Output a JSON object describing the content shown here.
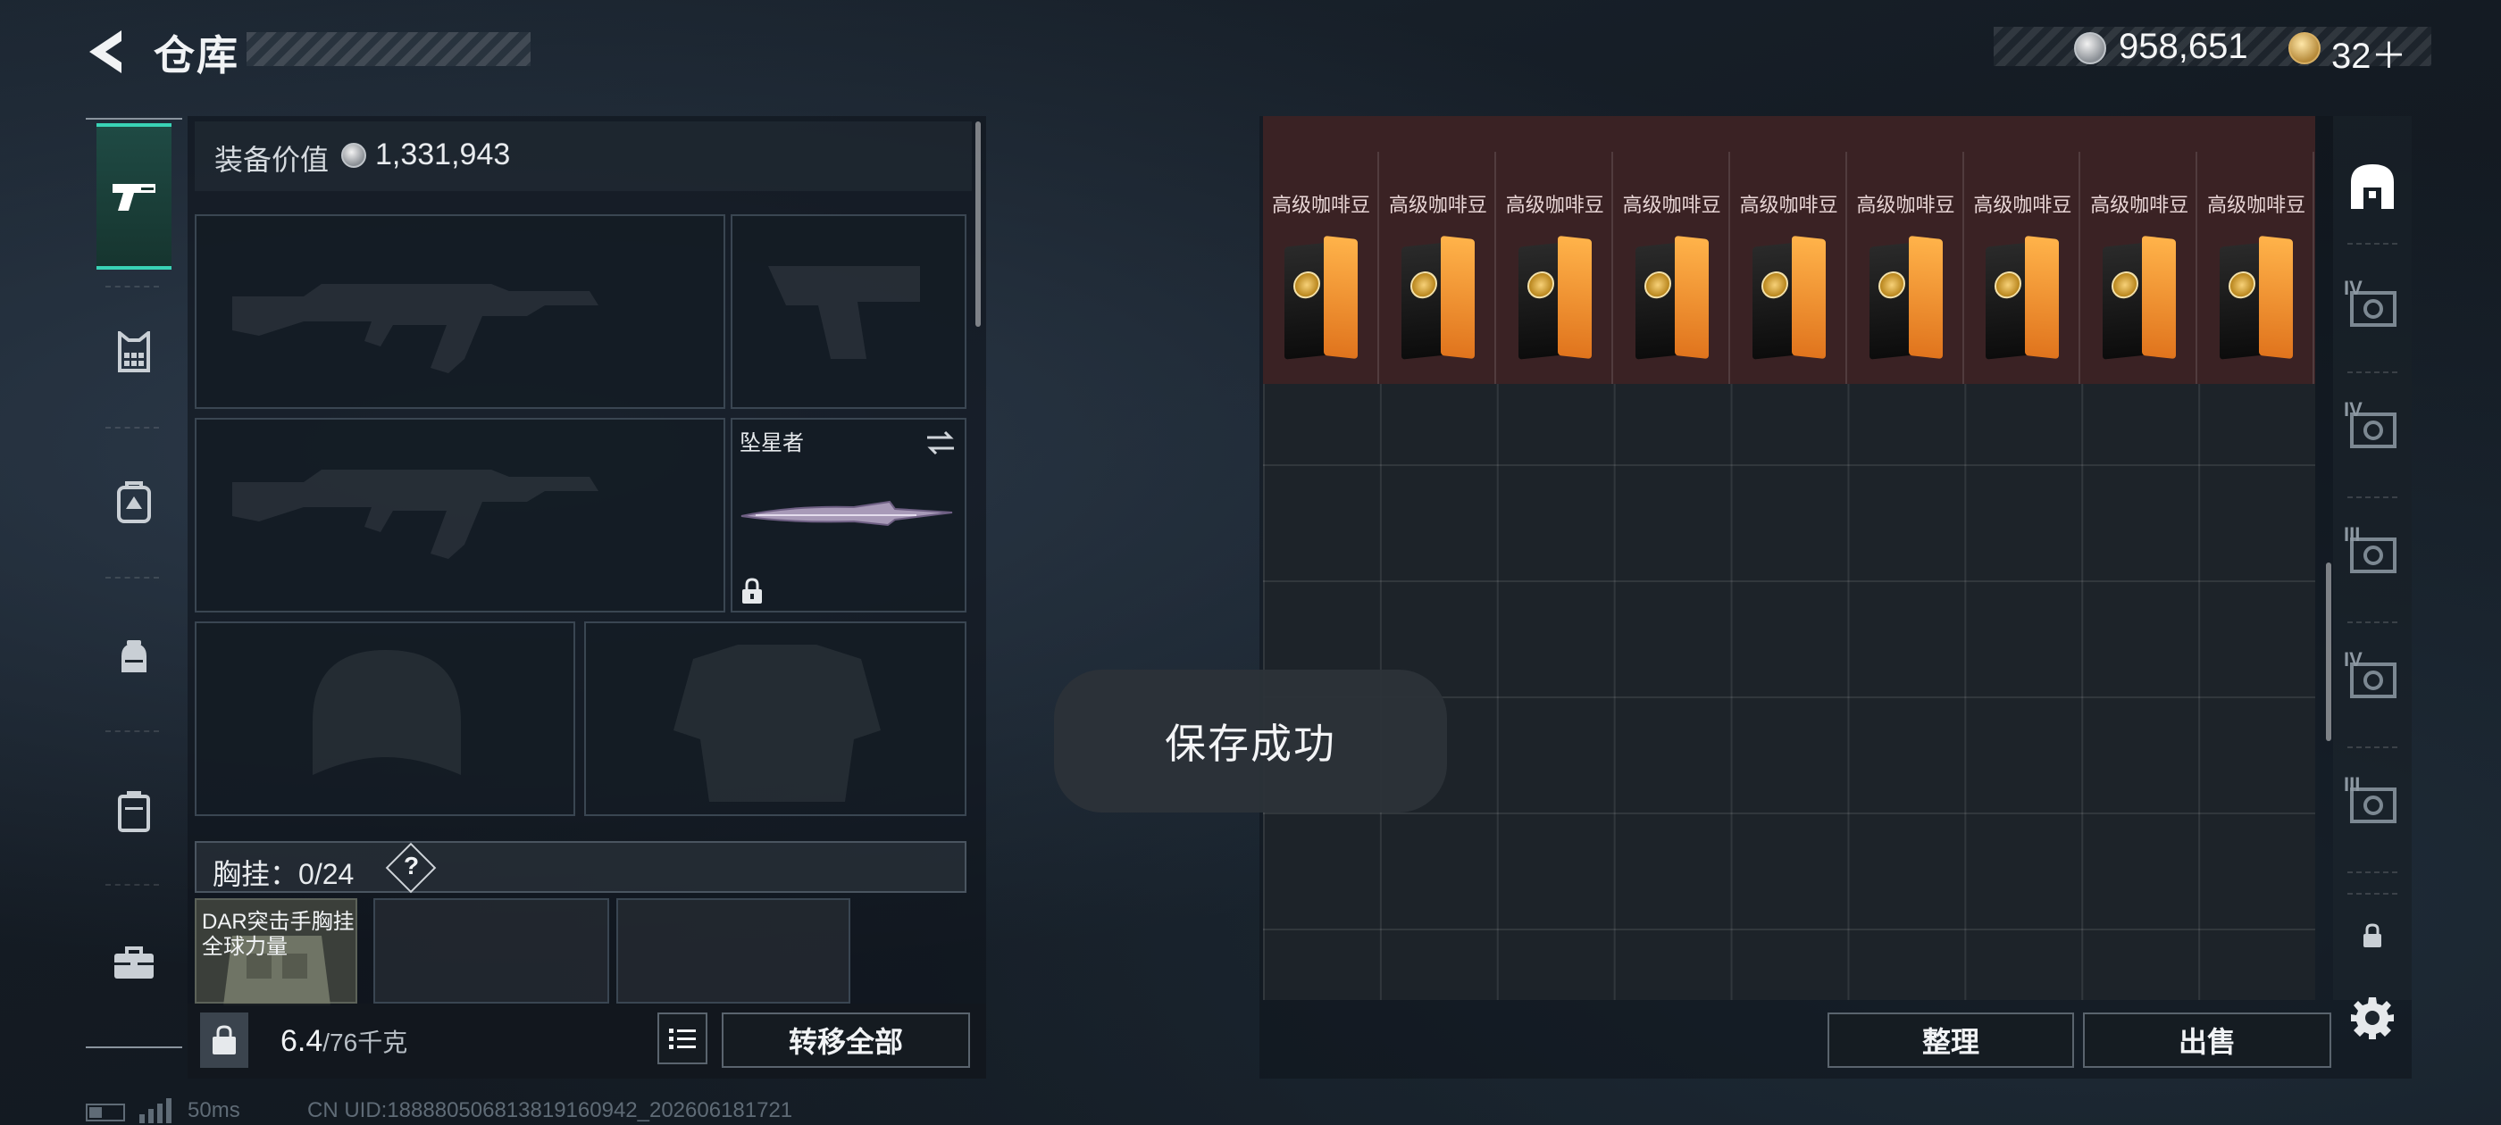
{
  "header": {
    "title": "仓库",
    "currency_silver": "958,651",
    "currency_gold": "32＋"
  },
  "loadout": {
    "equip_value_label": "装备价值",
    "equip_value": "1,331,943",
    "melee_name": "坠星者",
    "chest_label": "胸挂：",
    "chest_count": "0/24",
    "help_label": "?",
    "chest_item_name": "DAR突击手胸挂",
    "chest_item_sub": "全球力量",
    "weight": "6.4",
    "weight_unit": "/76千克",
    "transfer_all": "转移全部"
  },
  "storage": {
    "items": [
      {
        "name": "高级咖啡豆"
      },
      {
        "name": "高级咖啡豆"
      },
      {
        "name": "高级咖啡豆"
      },
      {
        "name": "高级咖啡豆"
      },
      {
        "name": "高级咖啡豆"
      },
      {
        "name": "高级咖啡豆"
      },
      {
        "name": "高级咖啡豆"
      },
      {
        "name": "高级咖啡豆"
      },
      {
        "name": "高级咖啡豆"
      }
    ],
    "sort_label": "整理",
    "sell_label": "出售",
    "side_tier_labels": [
      "IV",
      "IV",
      "III",
      "IV",
      "III"
    ]
  },
  "toast": {
    "message": "保存成功"
  },
  "footer": {
    "ping": "50ms",
    "uid": "CN UID:18888050681381916094​2_202606181721"
  },
  "colors": {
    "accent": "#39d3b6",
    "item_bg": "#3a2224",
    "panel": "#0e141b"
  },
  "icons": [
    "back-arrow-icon",
    "silver-coin-icon",
    "gold-coin-icon",
    "pistol-icon",
    "vest-icon",
    "backpack-icon",
    "helmet-bag-icon",
    "case-icon",
    "toolbox-icon",
    "weight-lock-icon",
    "list-icon",
    "swap-icon",
    "lock-icon",
    "storage-home-icon",
    "gear-icon"
  ]
}
